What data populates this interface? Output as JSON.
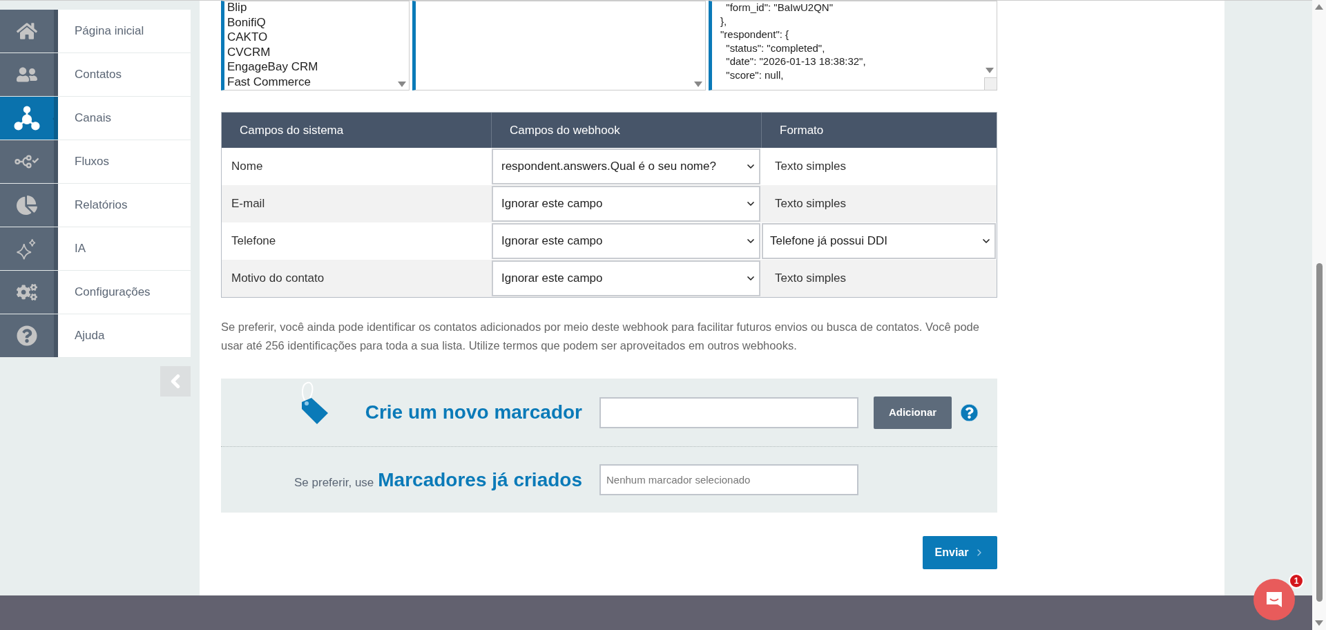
{
  "sidebar": {
    "items": [
      {
        "label": "Página inicial",
        "selected": false
      },
      {
        "label": "Contatos",
        "selected": false
      },
      {
        "label": "Canais",
        "selected": true
      },
      {
        "label": "Fluxos",
        "selected": false
      },
      {
        "label": "Relatórios",
        "selected": false
      },
      {
        "label": "IA",
        "selected": false
      },
      {
        "label": "Configurações",
        "selected": false
      },
      {
        "label": "Ajuda",
        "selected": false
      }
    ]
  },
  "integrations_list": [
    "Blip",
    "BonifiQ",
    "CAKTO",
    "CVCRM",
    "EngageBay CRM",
    "Fast Commerce"
  ],
  "payload_lines": [
    "  \"form_id\": \"BaIwU2QN\"",
    "},",
    "\"respondent\": {",
    "  \"status\": \"completed\",",
    "  \"date\": \"2026-01-13 18:38:32\",",
    "  \"score\": null,"
  ],
  "mapping_table": {
    "columns": [
      "Campos do sistema",
      "Campos do webhook",
      "Formato"
    ],
    "rows": [
      {
        "system_field": "Nome",
        "webhook_field": "respondent.answers.Qual é o seu nome?",
        "format": {
          "kind": "text",
          "value": "Texto simples"
        }
      },
      {
        "system_field": "E-mail",
        "webhook_field": "Ignorar este campo",
        "format": {
          "kind": "text",
          "value": "Texto simples"
        }
      },
      {
        "system_field": "Telefone",
        "webhook_field": "Ignorar este campo",
        "format": {
          "kind": "select",
          "value": "Telefone já possui DDI"
        }
      },
      {
        "system_field": "Motivo do contato",
        "webhook_field": "Ignorar este campo",
        "format": {
          "kind": "text",
          "value": "Texto simples"
        }
      }
    ]
  },
  "help_text": "Se preferir, você ainda pode identificar os contatos adicionados por meio deste webhook para facilitar futuros envios ou busca de contatos. Você pode usar até 256 identificações para toda a sua lista. Utilize termos que podem ser aproveitados em outros webhooks.",
  "new_tag": {
    "title": "Crie um novo marcador",
    "button": "Adicionar"
  },
  "existing_tags": {
    "prefix": "Se preferir, use",
    "title": "Marcadores já criados",
    "placeholder": "Nenhum marcador selecionado"
  },
  "submit_button": "Enviar",
  "chat_badge": "1"
}
